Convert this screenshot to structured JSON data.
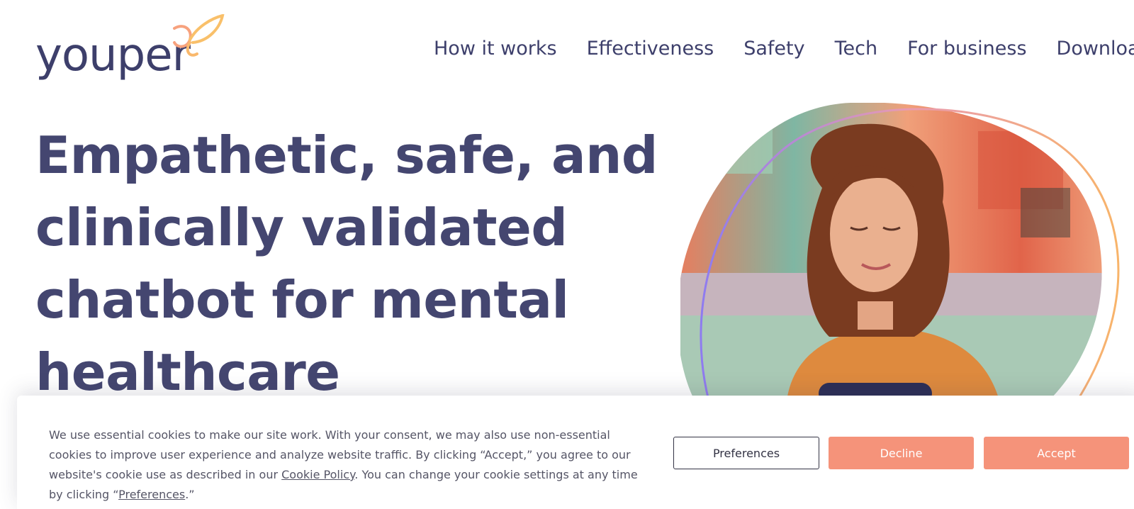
{
  "header": {
    "logo_text": "youper",
    "nav": [
      "How it works",
      "Effectiveness",
      "Safety",
      "Tech",
      "For business",
      "Download"
    ]
  },
  "hero": {
    "title": "Empathetic, safe, and clinically validated chatbot for mental healthcare"
  },
  "cookie": {
    "text_1": "We use essential cookies to make our site work. With your consent, we may also use non-essential cookies to improve user experience and analyze website traffic. By clicking “Accept,” you agree to our website's cookie use as described in our ",
    "policy_link": "Cookie Policy",
    "text_2": ". You can change your cookie settings at any time by clicking “",
    "preferences_link": "Preferences",
    "text_3": ".”",
    "buttons": {
      "preferences": "Preferences",
      "decline": "Decline",
      "accept": "Accept"
    }
  },
  "colors": {
    "brand_text": "#444670",
    "accent": "#f5937a"
  }
}
